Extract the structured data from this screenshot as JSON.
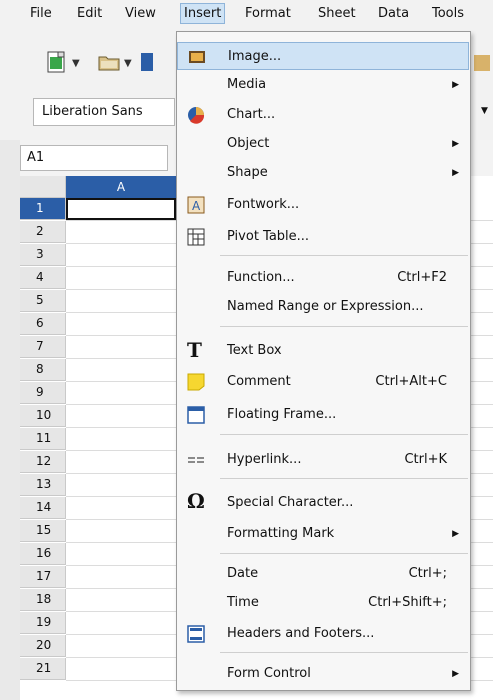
{
  "menubar": {
    "items": [
      {
        "label": "File"
      },
      {
        "label": "Edit"
      },
      {
        "label": "View"
      },
      {
        "label": "Insert"
      },
      {
        "label": "Format"
      },
      {
        "label": "Sheet"
      },
      {
        "label": "Data"
      },
      {
        "label": "Tools"
      }
    ]
  },
  "toolbar": {
    "font_name": "Liberation Sans",
    "name_box": "A1"
  },
  "grid": {
    "column_a": "A",
    "rows": [
      "1",
      "2",
      "3",
      "4",
      "5",
      "6",
      "7",
      "8",
      "9",
      "10",
      "11",
      "12",
      "13",
      "14",
      "15",
      "16",
      "17",
      "18",
      "19",
      "20",
      "21"
    ]
  },
  "insert_menu": {
    "image": "Image...",
    "media": "Media",
    "chart": "Chart...",
    "object": "Object",
    "shape": "Shape",
    "fontwork": "Fontwork...",
    "pivot_table": "Pivot Table...",
    "function": "Function...",
    "function_shortcut": "Ctrl+F2",
    "named_range": "Named Range or Expression...",
    "text_box": "Text Box",
    "comment": "Comment",
    "comment_shortcut": "Ctrl+Alt+C",
    "floating_frame": "Floating Frame...",
    "hyperlink": "Hyperlink...",
    "hyperlink_shortcut": "Ctrl+K",
    "special_character": "Special Character...",
    "formatting_mark": "Formatting Mark",
    "date": "Date",
    "date_shortcut": "Ctrl+;",
    "time": "Time",
    "time_shortcut": "Ctrl+Shift+;",
    "headers_footers": "Headers and Footers...",
    "form_control": "Form Control"
  },
  "colors": {
    "highlight": "#cfe3f5",
    "selection": "#2b5ea7"
  }
}
